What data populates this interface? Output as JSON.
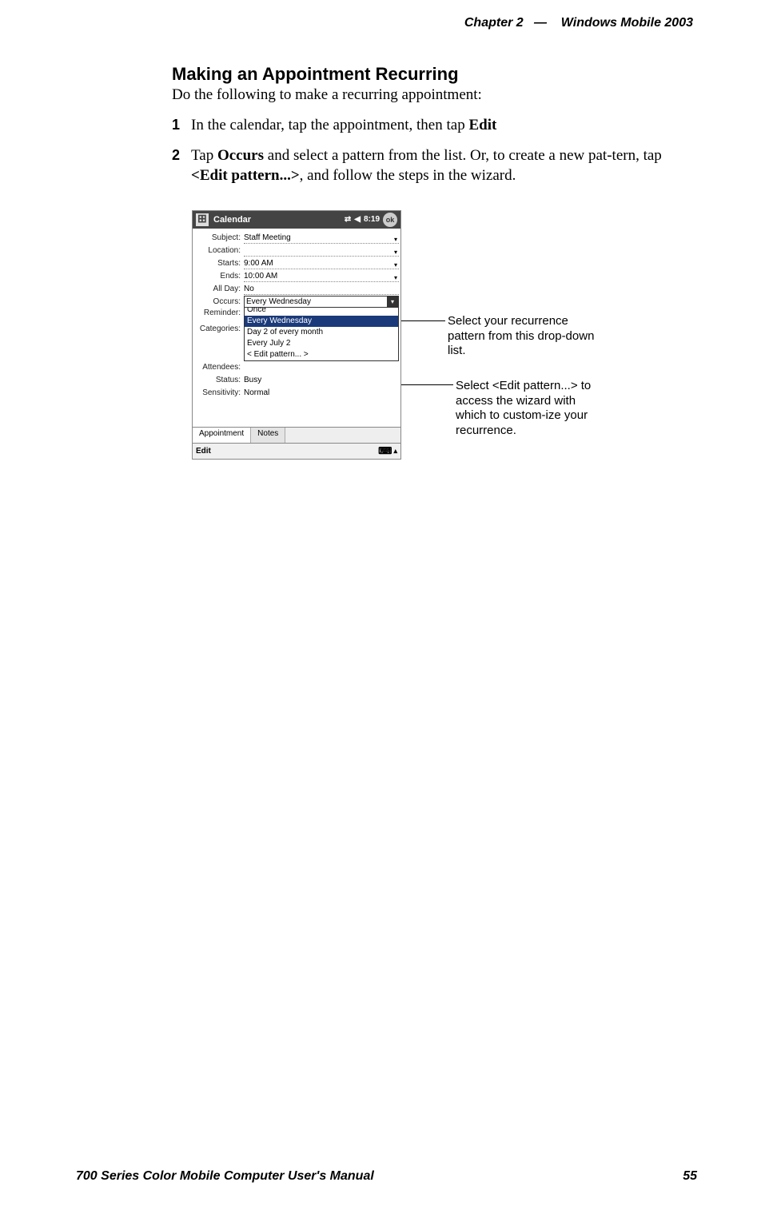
{
  "header": {
    "chapter": "Chapter  2",
    "dash": "—",
    "product": "Windows Mobile 2003"
  },
  "section": {
    "title": "Making an Appointment Recurring",
    "intro": "Do the following to make a recurring appointment:"
  },
  "steps": {
    "one": {
      "num": "1",
      "t1": "In the calendar, tap the appointment, then tap ",
      "edit": "Edit"
    },
    "two": {
      "num": "2",
      "t1": "Tap ",
      "occurs": "Occurs",
      "t2": " and select a pattern from the list. Or, to create a new pat-tern, tap ",
      "editpat": "<Edit pattern...>",
      "t3": ", and follow the steps in the wizard."
    }
  },
  "screenshot": {
    "title": "Calendar",
    "time": "8:19",
    "ok": "ok",
    "labels": {
      "subject": "Subject:",
      "location": "Location:",
      "starts": "Starts:",
      "ends": "Ends:",
      "allday": "All Day:",
      "occurs": "Occurs:",
      "reminder": "Reminder:",
      "categories": "Categories:",
      "attendees": "Attendees:",
      "status": "Status:",
      "sensitivity": "Sensitivity:"
    },
    "values": {
      "subject": "Staff Meeting",
      "location": "",
      "starts": "9:00 AM",
      "ends": "10:00 AM",
      "allday": "No",
      "occurs": "Every Wednesday",
      "status": "Busy",
      "sensitivity": "Normal"
    },
    "dropdown": {
      "once": "Once",
      "everywed": "Every Wednesday",
      "day2": "Day 2 of every month",
      "july2": "Every July 2",
      "editpat": "< Edit pattern... >"
    },
    "tabs": {
      "appointment": "Appointment",
      "notes": "Notes"
    },
    "bottom": {
      "edit": "Edit"
    }
  },
  "callouts": {
    "c1": "Select your recurrence pattern from this drop-down list.",
    "c2": "Select <Edit pattern...> to access the wizard with which to custom-ize your recurrence."
  },
  "footer": {
    "manual": "700 Series Color Mobile Computer User's Manual",
    "page": "55"
  }
}
